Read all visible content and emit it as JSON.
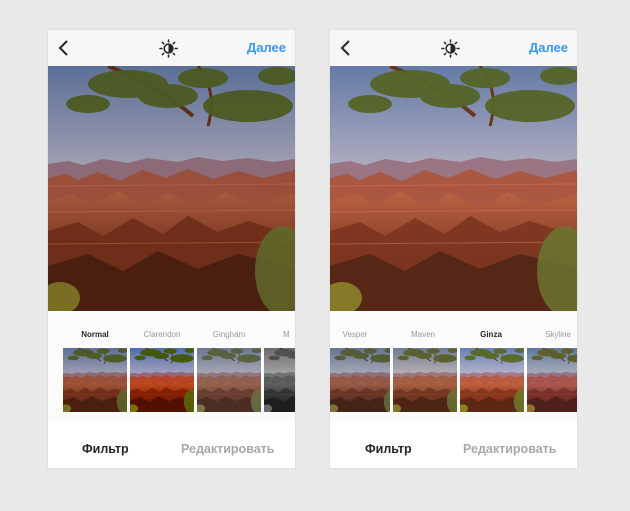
{
  "screens": [
    {
      "header": {
        "next_label": "Далее"
      },
      "filters": {
        "labels": [
          "Normal",
          "Clarendon",
          "Gingham",
          "M"
        ],
        "selected": "Normal",
        "thumbnail_styles": [
          "normal",
          "vivid",
          "faded",
          "grayscale"
        ]
      },
      "tabs": {
        "filter_label": "Фильтр",
        "edit_label": "Редактировать",
        "active": "filter"
      },
      "photo_style": "normal"
    },
    {
      "header": {
        "next_label": "Далее"
      },
      "filters": {
        "labels": [
          "Vesper",
          "Maven",
          "Ginza",
          "Skyline"
        ],
        "selected": "Ginza",
        "thumbnail_styles": [
          "muted",
          "warm",
          "bright",
          "cool"
        ]
      },
      "tabs": {
        "filter_label": "Фильтр",
        "edit_label": "Редактировать",
        "active": "filter"
      },
      "photo_style": "ginza"
    }
  ],
  "colors": {
    "accent": "#3897f0",
    "text_active": "#262626",
    "text_inactive": "#a8a8a8"
  },
  "icons": {
    "back": "chevron-left-icon",
    "brightness": "brightness-icon"
  }
}
